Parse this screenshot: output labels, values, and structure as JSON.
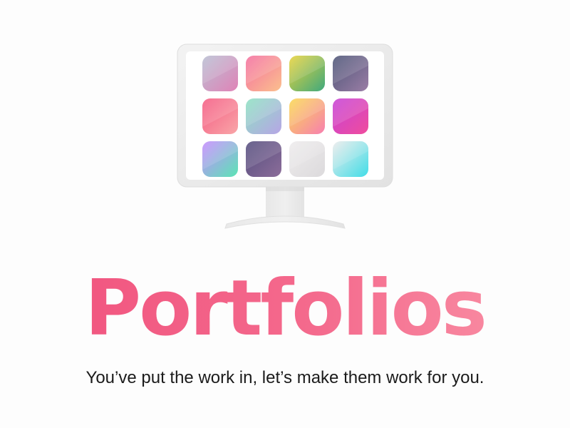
{
  "hero": {
    "title": "Portfolios",
    "tagline": "You’ve put the work in, let’s make them work for you."
  },
  "illustration": {
    "icon": "desktop-monitor-icon",
    "tiles": [
      {
        "name": "tile-lavender-pink",
        "from": "#b9bfd3",
        "to": "#e083b7"
      },
      {
        "name": "tile-pink-peach",
        "from": "#f46fa0",
        "to": "#fbc08e"
      },
      {
        "name": "tile-yellow-green",
        "from": "#e9d33c",
        "to": "#3fa97d"
      },
      {
        "name": "tile-slate-mauve",
        "from": "#4d5577",
        "to": "#9b7ea6"
      },
      {
        "name": "tile-coral-pink",
        "from": "#f45c83",
        "to": "#f9a6a8"
      },
      {
        "name": "tile-mint-lilac",
        "from": "#8ee2c2",
        "to": "#b7a5e6"
      },
      {
        "name": "tile-yellow-rose",
        "from": "#fbd952",
        "to": "#f77fb0"
      },
      {
        "name": "tile-magenta-violet",
        "from": "#c742d6",
        "to": "#f04d9d"
      },
      {
        "name": "tile-violet-mint",
        "from": "#c68bff",
        "to": "#5be5b5"
      },
      {
        "name": "tile-plum-slate",
        "from": "#554e7e",
        "to": "#8c6d9a"
      },
      {
        "name": "tile-light-grey",
        "from": "#eeeced",
        "to": "#dcdadc"
      },
      {
        "name": "tile-white-cyan",
        "from": "#ececec",
        "to": "#41dde7"
      }
    ]
  }
}
